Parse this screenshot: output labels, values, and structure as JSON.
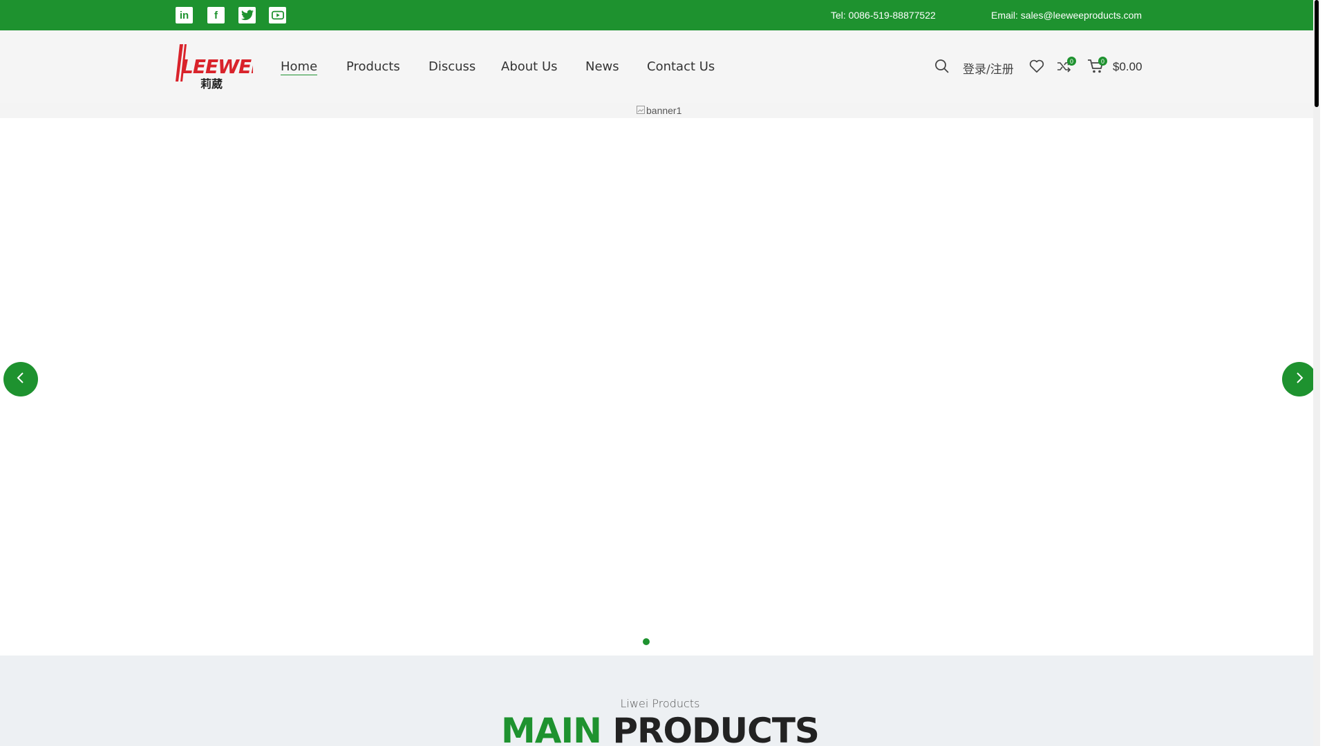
{
  "colors": {
    "brand_green": "#1e922f",
    "topbar": "#1e922f",
    "logo_red": "#d9232b"
  },
  "topbar": {
    "social": [
      {
        "name": "linkedin-icon",
        "glyph": "in"
      },
      {
        "name": "facebook-icon",
        "glyph": "f"
      },
      {
        "name": "twitter-icon",
        "glyph": "t"
      },
      {
        "name": "youtube-icon",
        "glyph": "▶"
      }
    ],
    "tel": "Tel: 0086-519-88877522",
    "email": "Email: sales@leeweeproducts.com"
  },
  "header": {
    "logo_text": "LEEWEE",
    "logo_cn": "莉葳",
    "nav": [
      "Home",
      "Products",
      "Discuss",
      "About Us",
      "News",
      "Contact Us"
    ],
    "active_nav": "Home",
    "login": "登录/注册",
    "compare_count": "0",
    "cart_count": "0",
    "cart_total": "$0.00"
  },
  "banner": {
    "alt": "banner1",
    "slides": 1,
    "active_slide": 1
  },
  "section": {
    "subtitle": "Liwei Products",
    "title_green": "MAIN",
    "title_dark": "PRODUCTS"
  }
}
